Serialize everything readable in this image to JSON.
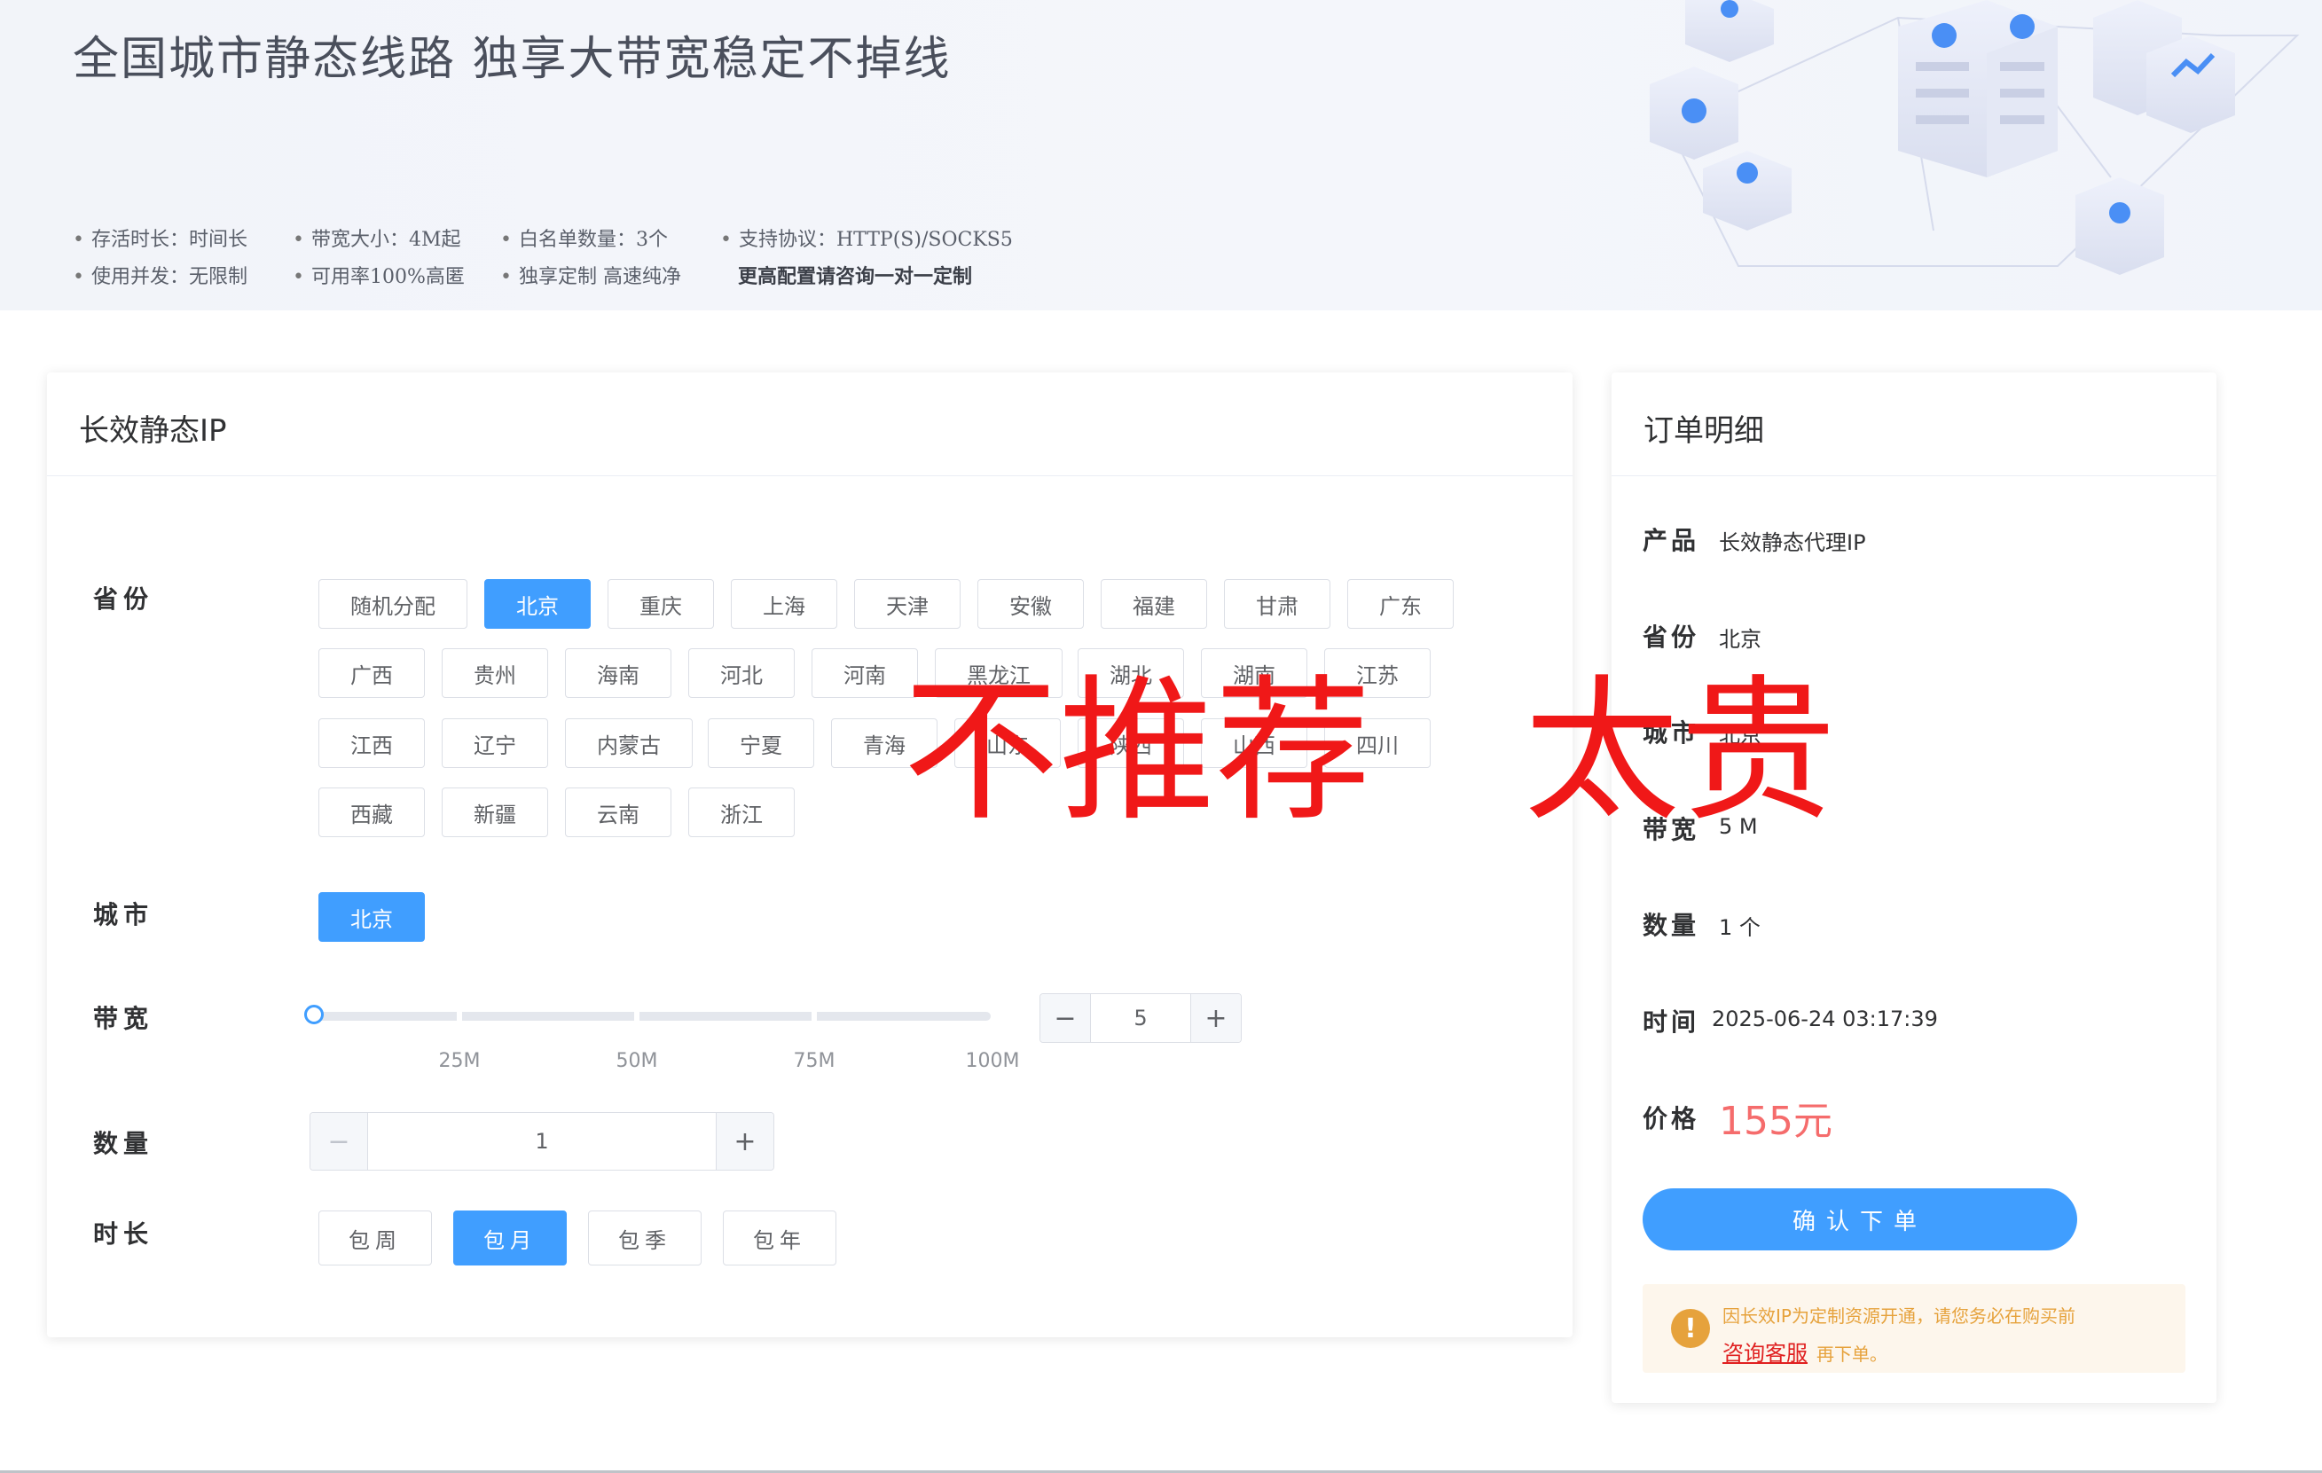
{
  "banner": {
    "title": "全国城市静态线路  独享大带宽稳定不掉线",
    "features": [
      "存活时长：时间长",
      "带宽大小：4M起",
      "白名单数量：3个",
      "支持协议：HTTP(S)/SOCKS5",
      "使用并发：无限制",
      "可用率100%高匿",
      "独享定制 高速纯净",
      "更高配置请咨询一对一定制"
    ]
  },
  "product_card": {
    "title": "长效静态IP",
    "province_label": "省份",
    "provinces": [
      "随机分配",
      "北京",
      "重庆",
      "上海",
      "天津",
      "安徽",
      "福建",
      "甘肃",
      "广东",
      "广西",
      "贵州",
      "海南",
      "河北",
      "河南",
      "黑龙江",
      "湖北",
      "湖南",
      "江苏",
      "江西",
      "辽宁",
      "内蒙古",
      "宁夏",
      "青海",
      "山东",
      "陕西",
      "山西",
      "四川",
      "西藏",
      "新疆",
      "云南",
      "浙江"
    ],
    "selected_province": "北京",
    "city_label": "城市",
    "cities": [
      "北京"
    ],
    "bandwidth_label": "带宽",
    "bandwidth_marks": [
      "25M",
      "50M",
      "75M",
      "100M"
    ],
    "bandwidth_value": "5",
    "bandwidth_minus": "−",
    "bandwidth_plus": "+",
    "quantity_label": "数量",
    "quantity_value": "1",
    "quantity_minus": "−",
    "quantity_plus": "+",
    "duration_label": "时长",
    "durations": [
      "包周",
      "包月",
      "包季",
      "包年"
    ],
    "selected_duration": "包月"
  },
  "order_card": {
    "title": "订单明细",
    "product_label": "产品",
    "product_value": "长效静态代理IP",
    "province_label": "省份",
    "province_value": "北京",
    "city_label": "城市",
    "city_value": "北京",
    "bandwidth_label": "带宽",
    "bandwidth_value": "5 M",
    "quantity_label": "数量",
    "quantity_value": "1 个",
    "time_label": "时间",
    "time_value": "2025-06-24 03:17:39",
    "price_label": "价格",
    "price_value": "155元",
    "confirm_label": "确认下单",
    "notice_icon": "!",
    "notice_text": "因长效IP为定制资源开通，请您务必在购买前",
    "notice_link": "咨询客服",
    "notice_tail": "再下单。"
  },
  "overlay": {
    "left_text": "不推荐",
    "right_text": "太贵"
  },
  "colors": {
    "accent": "#409eff",
    "price": "#f56c6c",
    "warning": "#e6a23c",
    "overlay": "#f01818"
  }
}
